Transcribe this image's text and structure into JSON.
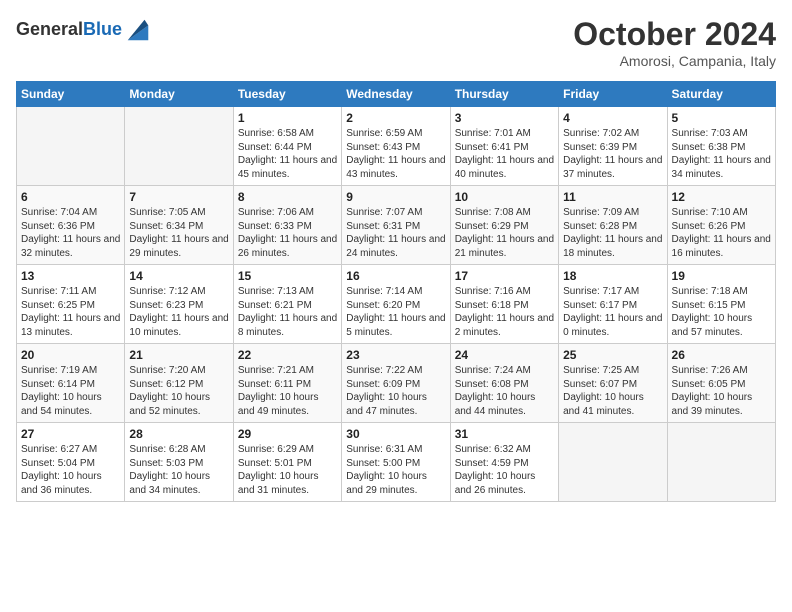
{
  "header": {
    "logo_line1": "General",
    "logo_line2": "Blue",
    "month": "October 2024",
    "location": "Amorosi, Campania, Italy"
  },
  "days_of_week": [
    "Sunday",
    "Monday",
    "Tuesday",
    "Wednesday",
    "Thursday",
    "Friday",
    "Saturday"
  ],
  "weeks": [
    [
      null,
      null,
      {
        "day": "1",
        "sunrise": "Sunrise: 6:58 AM",
        "sunset": "Sunset: 6:44 PM",
        "daylight": "Daylight: 11 hours and 45 minutes."
      },
      {
        "day": "2",
        "sunrise": "Sunrise: 6:59 AM",
        "sunset": "Sunset: 6:43 PM",
        "daylight": "Daylight: 11 hours and 43 minutes."
      },
      {
        "day": "3",
        "sunrise": "Sunrise: 7:01 AM",
        "sunset": "Sunset: 6:41 PM",
        "daylight": "Daylight: 11 hours and 40 minutes."
      },
      {
        "day": "4",
        "sunrise": "Sunrise: 7:02 AM",
        "sunset": "Sunset: 6:39 PM",
        "daylight": "Daylight: 11 hours and 37 minutes."
      },
      {
        "day": "5",
        "sunrise": "Sunrise: 7:03 AM",
        "sunset": "Sunset: 6:38 PM",
        "daylight": "Daylight: 11 hours and 34 minutes."
      }
    ],
    [
      {
        "day": "6",
        "sunrise": "Sunrise: 7:04 AM",
        "sunset": "Sunset: 6:36 PM",
        "daylight": "Daylight: 11 hours and 32 minutes."
      },
      {
        "day": "7",
        "sunrise": "Sunrise: 7:05 AM",
        "sunset": "Sunset: 6:34 PM",
        "daylight": "Daylight: 11 hours and 29 minutes."
      },
      {
        "day": "8",
        "sunrise": "Sunrise: 7:06 AM",
        "sunset": "Sunset: 6:33 PM",
        "daylight": "Daylight: 11 hours and 26 minutes."
      },
      {
        "day": "9",
        "sunrise": "Sunrise: 7:07 AM",
        "sunset": "Sunset: 6:31 PM",
        "daylight": "Daylight: 11 hours and 24 minutes."
      },
      {
        "day": "10",
        "sunrise": "Sunrise: 7:08 AM",
        "sunset": "Sunset: 6:29 PM",
        "daylight": "Daylight: 11 hours and 21 minutes."
      },
      {
        "day": "11",
        "sunrise": "Sunrise: 7:09 AM",
        "sunset": "Sunset: 6:28 PM",
        "daylight": "Daylight: 11 hours and 18 minutes."
      },
      {
        "day": "12",
        "sunrise": "Sunrise: 7:10 AM",
        "sunset": "Sunset: 6:26 PM",
        "daylight": "Daylight: 11 hours and 16 minutes."
      }
    ],
    [
      {
        "day": "13",
        "sunrise": "Sunrise: 7:11 AM",
        "sunset": "Sunset: 6:25 PM",
        "daylight": "Daylight: 11 hours and 13 minutes."
      },
      {
        "day": "14",
        "sunrise": "Sunrise: 7:12 AM",
        "sunset": "Sunset: 6:23 PM",
        "daylight": "Daylight: 11 hours and 10 minutes."
      },
      {
        "day": "15",
        "sunrise": "Sunrise: 7:13 AM",
        "sunset": "Sunset: 6:21 PM",
        "daylight": "Daylight: 11 hours and 8 minutes."
      },
      {
        "day": "16",
        "sunrise": "Sunrise: 7:14 AM",
        "sunset": "Sunset: 6:20 PM",
        "daylight": "Daylight: 11 hours and 5 minutes."
      },
      {
        "day": "17",
        "sunrise": "Sunrise: 7:16 AM",
        "sunset": "Sunset: 6:18 PM",
        "daylight": "Daylight: 11 hours and 2 minutes."
      },
      {
        "day": "18",
        "sunrise": "Sunrise: 7:17 AM",
        "sunset": "Sunset: 6:17 PM",
        "daylight": "Daylight: 11 hours and 0 minutes."
      },
      {
        "day": "19",
        "sunrise": "Sunrise: 7:18 AM",
        "sunset": "Sunset: 6:15 PM",
        "daylight": "Daylight: 10 hours and 57 minutes."
      }
    ],
    [
      {
        "day": "20",
        "sunrise": "Sunrise: 7:19 AM",
        "sunset": "Sunset: 6:14 PM",
        "daylight": "Daylight: 10 hours and 54 minutes."
      },
      {
        "day": "21",
        "sunrise": "Sunrise: 7:20 AM",
        "sunset": "Sunset: 6:12 PM",
        "daylight": "Daylight: 10 hours and 52 minutes."
      },
      {
        "day": "22",
        "sunrise": "Sunrise: 7:21 AM",
        "sunset": "Sunset: 6:11 PM",
        "daylight": "Daylight: 10 hours and 49 minutes."
      },
      {
        "day": "23",
        "sunrise": "Sunrise: 7:22 AM",
        "sunset": "Sunset: 6:09 PM",
        "daylight": "Daylight: 10 hours and 47 minutes."
      },
      {
        "day": "24",
        "sunrise": "Sunrise: 7:24 AM",
        "sunset": "Sunset: 6:08 PM",
        "daylight": "Daylight: 10 hours and 44 minutes."
      },
      {
        "day": "25",
        "sunrise": "Sunrise: 7:25 AM",
        "sunset": "Sunset: 6:07 PM",
        "daylight": "Daylight: 10 hours and 41 minutes."
      },
      {
        "day": "26",
        "sunrise": "Sunrise: 7:26 AM",
        "sunset": "Sunset: 6:05 PM",
        "daylight": "Daylight: 10 hours and 39 minutes."
      }
    ],
    [
      {
        "day": "27",
        "sunrise": "Sunrise: 6:27 AM",
        "sunset": "Sunset: 5:04 PM",
        "daylight": "Daylight: 10 hours and 36 minutes."
      },
      {
        "day": "28",
        "sunrise": "Sunrise: 6:28 AM",
        "sunset": "Sunset: 5:03 PM",
        "daylight": "Daylight: 10 hours and 34 minutes."
      },
      {
        "day": "29",
        "sunrise": "Sunrise: 6:29 AM",
        "sunset": "Sunset: 5:01 PM",
        "daylight": "Daylight: 10 hours and 31 minutes."
      },
      {
        "day": "30",
        "sunrise": "Sunrise: 6:31 AM",
        "sunset": "Sunset: 5:00 PM",
        "daylight": "Daylight: 10 hours and 29 minutes."
      },
      {
        "day": "31",
        "sunrise": "Sunrise: 6:32 AM",
        "sunset": "Sunset: 4:59 PM",
        "daylight": "Daylight: 10 hours and 26 minutes."
      },
      null,
      null
    ]
  ]
}
